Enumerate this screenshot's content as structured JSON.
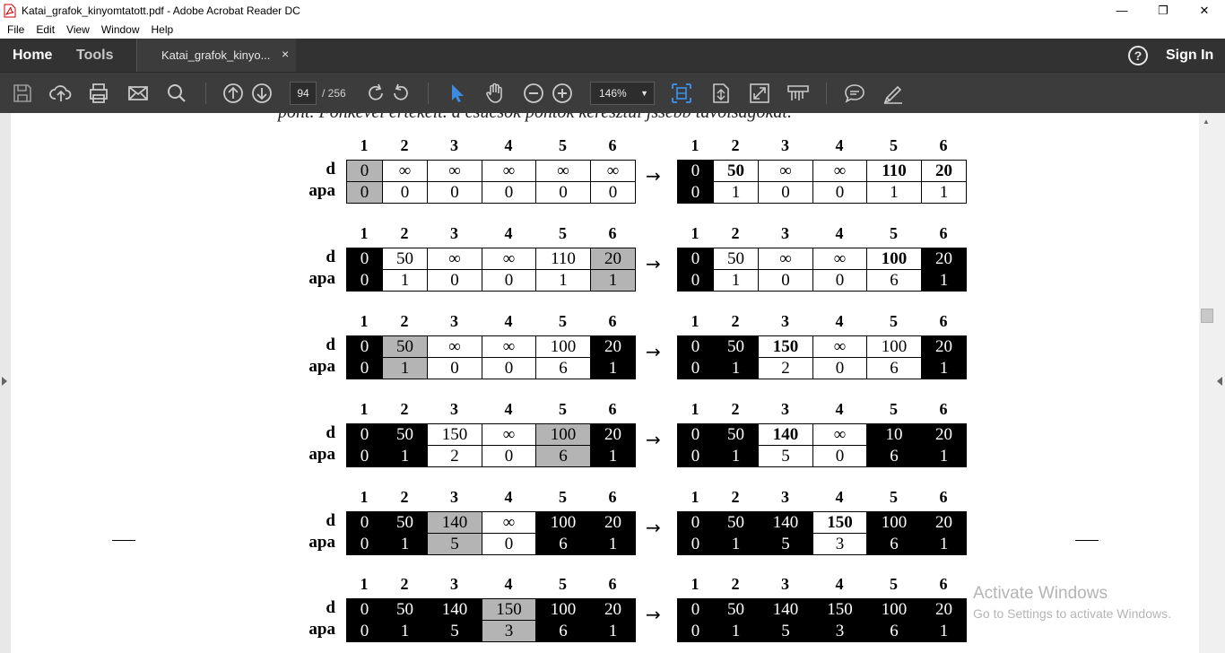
{
  "window": {
    "title": "Katai_grafok_kinyomtatott.pdf - Adobe Acrobat Reader DC",
    "controls": [
      "—",
      "❐",
      "✕"
    ]
  },
  "menu": [
    "File",
    "Edit",
    "View",
    "Window",
    "Help"
  ],
  "tabs": {
    "home": "Home",
    "tools": "Tools",
    "document": "Katai_grafok_kinyo...",
    "close": "×",
    "help": "?",
    "sign_in": "Sign In"
  },
  "toolbar": {
    "page_current": "94",
    "page_total": "/  256",
    "zoom": "146%"
  },
  "document": {
    "cut_line": "pont. Fönkével értékeit. a csúcsok pontok keresztül jssebb távolságokat."
  },
  "tables": {
    "headers": [
      "1",
      "2",
      "3",
      "4",
      "5",
      "6"
    ],
    "row_labels": [
      "d",
      "apa"
    ],
    "arrow": "→",
    "steps": [
      {
        "left": {
          "d": [
            "0",
            "∞",
            "∞",
            "∞",
            "∞",
            "∞"
          ],
          "apa": [
            "0",
            "0",
            "0",
            "0",
            "0",
            "0"
          ],
          "states": [
            "g",
            "w",
            "w",
            "w",
            "w",
            "w"
          ]
        },
        "right": {
          "d": [
            "0",
            "50",
            "∞",
            "∞",
            "110",
            "20"
          ],
          "apa": [
            "0",
            "1",
            "0",
            "0",
            "1",
            "1"
          ],
          "states": [
            "b",
            "w",
            "w",
            "w",
            "w",
            "w"
          ],
          "bold": [
            false,
            true,
            false,
            false,
            true,
            true
          ]
        }
      },
      {
        "left": {
          "d": [
            "0",
            "50",
            "∞",
            "∞",
            "110",
            "20"
          ],
          "apa": [
            "0",
            "1",
            "0",
            "0",
            "1",
            "1"
          ],
          "states": [
            "b",
            "w",
            "w",
            "w",
            "w",
            "g"
          ]
        },
        "right": {
          "d": [
            "0",
            "50",
            "∞",
            "∞",
            "100",
            "20"
          ],
          "apa": [
            "0",
            "1",
            "0",
            "0",
            "6",
            "1"
          ],
          "states": [
            "b",
            "w",
            "w",
            "w",
            "w",
            "b"
          ],
          "bold": [
            false,
            false,
            false,
            false,
            true,
            false
          ]
        }
      },
      {
        "left": {
          "d": [
            "0",
            "50",
            "∞",
            "∞",
            "100",
            "20"
          ],
          "apa": [
            "0",
            "1",
            "0",
            "0",
            "6",
            "1"
          ],
          "states": [
            "b",
            "g",
            "w",
            "w",
            "w",
            "b"
          ]
        },
        "right": {
          "d": [
            "0",
            "50",
            "150",
            "∞",
            "100",
            "20"
          ],
          "apa": [
            "0",
            "1",
            "2",
            "0",
            "6",
            "1"
          ],
          "states": [
            "b",
            "b",
            "w",
            "w",
            "w",
            "b"
          ],
          "bold": [
            false,
            false,
            true,
            false,
            false,
            false
          ]
        }
      },
      {
        "left": {
          "d": [
            "0",
            "50",
            "150",
            "∞",
            "100",
            "20"
          ],
          "apa": [
            "0",
            "1",
            "2",
            "0",
            "6",
            "1"
          ],
          "states": [
            "b",
            "b",
            "w",
            "w",
            "g",
            "b"
          ]
        },
        "right": {
          "d": [
            "0",
            "50",
            "140",
            "∞",
            "10",
            "20"
          ],
          "apa": [
            "0",
            "1",
            "5",
            "0",
            "6",
            "1"
          ],
          "states": [
            "b",
            "b",
            "w",
            "w",
            "b",
            "b"
          ],
          "bold": [
            false,
            false,
            true,
            false,
            false,
            false
          ]
        }
      },
      {
        "left": {
          "d": [
            "0",
            "50",
            "140",
            "∞",
            "100",
            "20"
          ],
          "apa": [
            "0",
            "1",
            "5",
            "0",
            "6",
            "1"
          ],
          "states": [
            "b",
            "b",
            "g",
            "w",
            "b",
            "b"
          ]
        },
        "right": {
          "d": [
            "0",
            "50",
            "140",
            "150",
            "100",
            "20"
          ],
          "apa": [
            "0",
            "1",
            "5",
            "3",
            "6",
            "1"
          ],
          "states": [
            "b",
            "b",
            "b",
            "w",
            "b",
            "b"
          ],
          "bold": [
            false,
            false,
            false,
            true,
            false,
            false
          ]
        }
      },
      {
        "left": {
          "d": [
            "0",
            "50",
            "140",
            "150",
            "100",
            "20"
          ],
          "apa": [
            "0",
            "1",
            "5",
            "3",
            "6",
            "1"
          ],
          "states": [
            "b",
            "b",
            "b",
            "g",
            "b",
            "b"
          ]
        },
        "right": {
          "d": [
            "0",
            "50",
            "140",
            "150",
            "100",
            "20"
          ],
          "apa": [
            "0",
            "1",
            "5",
            "3",
            "6",
            "1"
          ],
          "states": [
            "b",
            "b",
            "b",
            "b",
            "b",
            "b"
          ],
          "bold": [
            false,
            false,
            false,
            false,
            false,
            false
          ]
        }
      }
    ]
  },
  "watermark": {
    "line1": "Activate Windows",
    "line2": "Go to Settings to activate Windows."
  }
}
